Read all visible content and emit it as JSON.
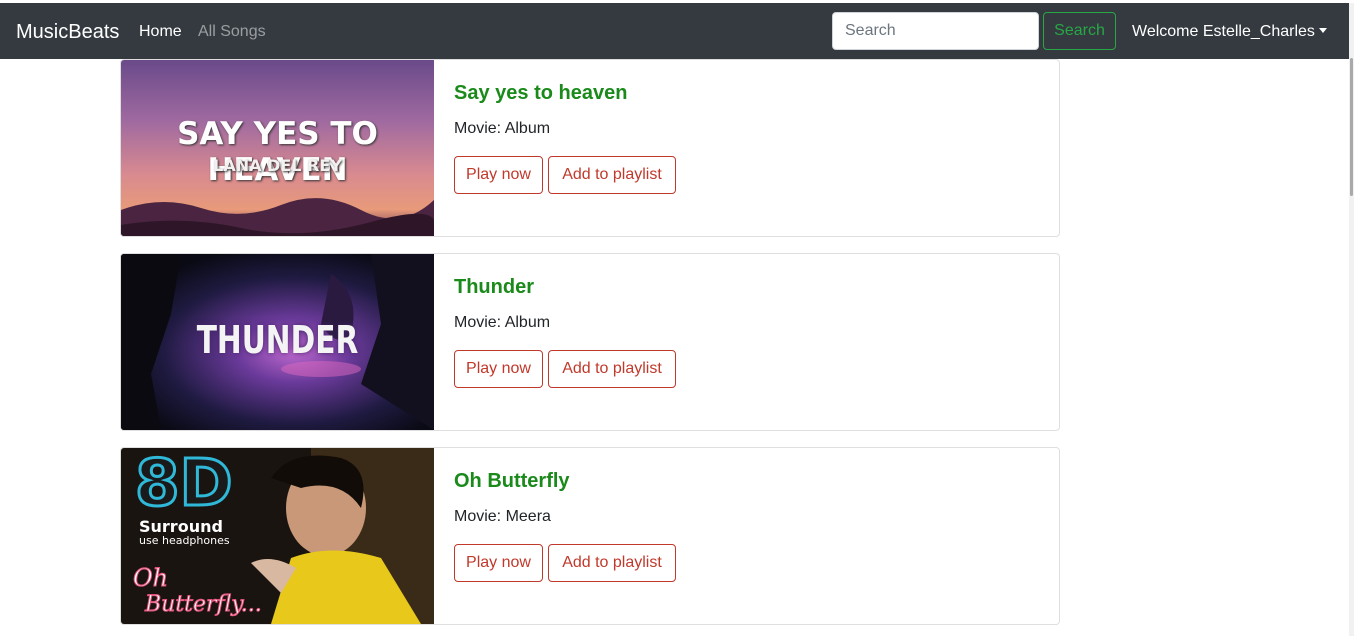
{
  "navbar": {
    "brand": "MusicBeats",
    "links": [
      "Home",
      "All Songs"
    ],
    "search_placeholder": "Search",
    "search_button": "Search",
    "user_menu": "Welcome Estelle_Charles"
  },
  "songs": [
    {
      "title": "Say yes to heaven",
      "movie": "Movie: Album",
      "play_label": "Play now",
      "playlist_label": "Add to playlist",
      "cover_text": [
        "SAY YES TO HEAVEN",
        "LANA DEL REY"
      ]
    },
    {
      "title": "Thunder",
      "movie": "Movie: Album",
      "play_label": "Play now",
      "playlist_label": "Add to playlist",
      "cover_text": [
        "THUNDER"
      ]
    },
    {
      "title": "Oh Butterfly",
      "movie": "Movie: Meera",
      "play_label": "Play now",
      "playlist_label": "Add to playlist",
      "cover_text": [
        "8D",
        "Surround",
        "use headphones",
        "Oh",
        "Butterfly..."
      ]
    }
  ],
  "colors": {
    "navbar_bg": "#343a40",
    "title_green": "#1a8a1a",
    "search_green": "#28a745",
    "button_red": "#c0392b"
  }
}
